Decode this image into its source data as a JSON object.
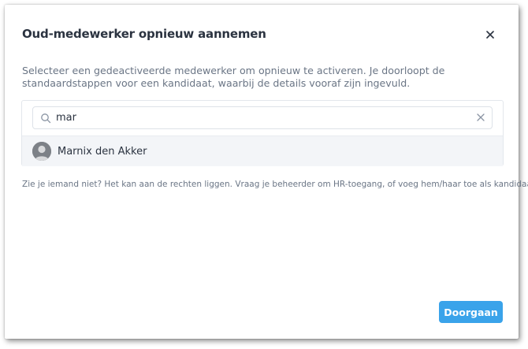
{
  "dialog": {
    "title": "Oud-medewerker opnieuw aannemen",
    "close_icon": "close-icon",
    "description": "Selecteer een gedeactiveerde medewerker om opnieuw te activeren. Je doorloopt de standaardstappen voor een kandidaat, waarbij de details vooraf zijn ingevuld.",
    "search": {
      "value": "mar",
      "search_icon": "search-icon",
      "clear_icon": "clear-icon"
    },
    "results": [
      {
        "name": "Marnix den Akker",
        "avatar_icon": "user-avatar-placeholder"
      }
    ],
    "hint": "Zie je iemand niet? Het kan aan de rechten liggen. Vraag je beheerder om HR-toegang, of voeg hem/haar toe als kandidaat.",
    "primary_button": "Doorgaan"
  },
  "colors": {
    "accent": "#3aa3ea",
    "text_dark": "#2b3340",
    "text_muted": "#6a7585",
    "result_bg": "#f3f5f8"
  }
}
